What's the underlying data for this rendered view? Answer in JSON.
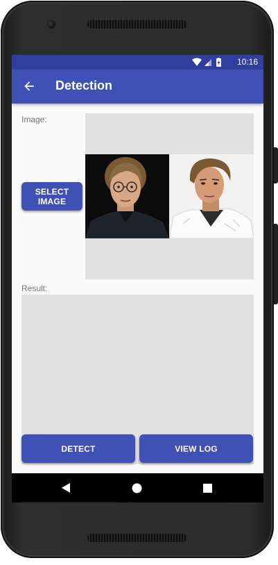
{
  "status_bar": {
    "time": "10:16",
    "color": "#303f9f"
  },
  "app_bar": {
    "title": "Detection",
    "color": "#3f51b5",
    "back_icon": "arrow-back-icon"
  },
  "image_section": {
    "label": "Image:",
    "select_button_label": "SELECT\nIMAGE",
    "photos": [
      "portrait-photo-glasses",
      "portrait-photo-white-jacket"
    ]
  },
  "result_section": {
    "label": "Result:"
  },
  "actions": {
    "detect_label": "DETECT",
    "view_log_label": "VIEW LOG"
  },
  "nav_bar": {
    "icons": [
      "back-triangle-icon",
      "home-circle-icon",
      "recents-square-icon"
    ]
  }
}
